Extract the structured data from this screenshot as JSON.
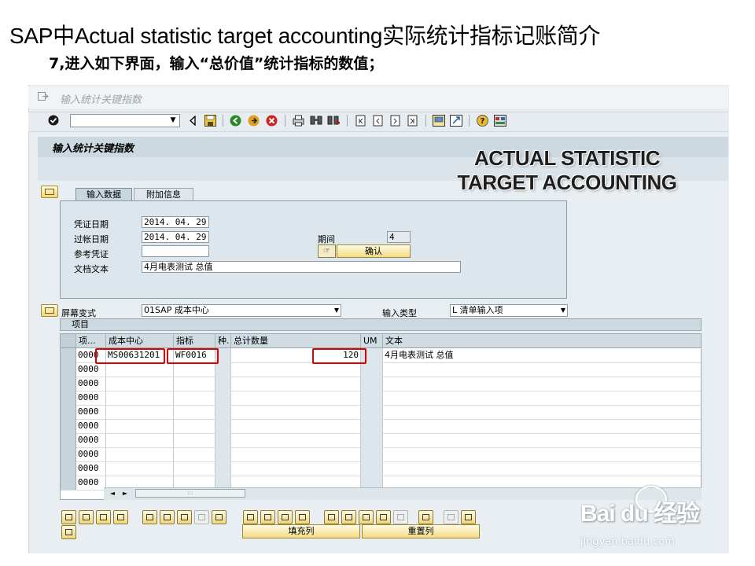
{
  "slide": {
    "title": "SAP中Actual statistic target  accounting实际统计指标记账简介",
    "subtitle": "7,进入如下界面，输入“总价值”统计指标的数值；"
  },
  "window": {
    "title": "输入统计关键指数",
    "screen_title": "输入统计关键指数",
    "overlay_title": "ACTUAL STATISTIC TARGET ACCOUNTING"
  },
  "toolbar": {
    "icons": [
      "enter-icon",
      "back-arrow-icon",
      "save-icon",
      "back-icon",
      "exit-icon",
      "cancel-icon",
      "print-icon",
      "find-icon",
      "find-next-icon",
      "first-page-icon",
      "previous-page-icon",
      "next-page-icon",
      "last-page-icon",
      "create-session-icon",
      "shortcut-icon",
      "help-icon",
      "layout-icon"
    ]
  },
  "tabs": [
    {
      "label": "输入数据",
      "active": true
    },
    {
      "label": "附加信息",
      "active": false
    }
  ],
  "header": {
    "doc_date_label": "凭证日期",
    "doc_date_value": "2014. 04. 29",
    "post_date_label": "过帐日期",
    "post_date_value": "2014. 04. 29",
    "reference_label": "参考凭证",
    "reference_value": "",
    "doc_text_label": "文档文本",
    "doc_text_value": "4月电表测试 总值",
    "period_label": "期间",
    "period_value": "4",
    "confirm_label": "确认"
  },
  "variant": {
    "label": "屏幕变式",
    "value": "01SAP 成本中心",
    "input_type_label": "输入类型",
    "input_type_value": "L 清单输入项"
  },
  "grid": {
    "title": "项目",
    "columns": [
      "项...",
      "成本中心",
      "指标",
      "种.",
      "总计数量",
      "UM",
      "文本"
    ],
    "rows": [
      {
        "item": "0000",
        "cost_center": "MS00631201",
        "kpi": "WF0016",
        "type": "",
        "qty": "120",
        "um": "",
        "text": "4月电表测试 总值"
      },
      {
        "item": "0000",
        "cost_center": "",
        "kpi": "",
        "type": "",
        "qty": "",
        "um": "",
        "text": ""
      },
      {
        "item": "0000",
        "cost_center": "",
        "kpi": "",
        "type": "",
        "qty": "",
        "um": "",
        "text": ""
      },
      {
        "item": "0000",
        "cost_center": "",
        "kpi": "",
        "type": "",
        "qty": "",
        "um": "",
        "text": ""
      },
      {
        "item": "0000",
        "cost_center": "",
        "kpi": "",
        "type": "",
        "qty": "",
        "um": "",
        "text": ""
      },
      {
        "item": "0000",
        "cost_center": "",
        "kpi": "",
        "type": "",
        "qty": "",
        "um": "",
        "text": ""
      },
      {
        "item": "0000",
        "cost_center": "",
        "kpi": "",
        "type": "",
        "qty": "",
        "um": "",
        "text": ""
      },
      {
        "item": "0000",
        "cost_center": "",
        "kpi": "",
        "type": "",
        "qty": "",
        "um": "",
        "text": ""
      },
      {
        "item": "0000",
        "cost_center": "",
        "kpi": "",
        "type": "",
        "qty": "",
        "um": "",
        "text": ""
      },
      {
        "item": "0000",
        "cost_center": "",
        "kpi": "",
        "type": "",
        "qty": "",
        "um": "",
        "text": ""
      }
    ]
  },
  "bottom": {
    "fill_column_label": "填充列",
    "reset_column_label": "重置列"
  },
  "watermark": {
    "logo": "Bai du 经验",
    "url": "jingyan.baidu.com"
  },
  "colors": {
    "highlight": "#e00000",
    "button": "#f3dc82",
    "panel": "#dde6ec"
  }
}
